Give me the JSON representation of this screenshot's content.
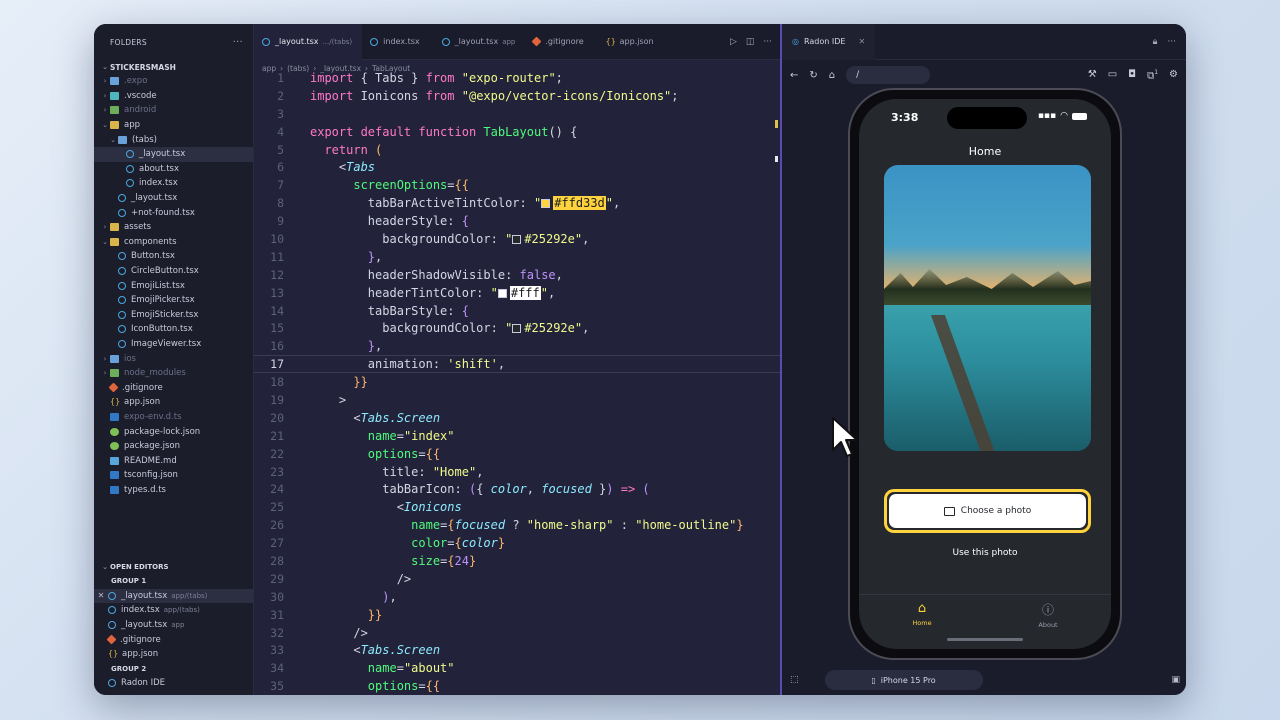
{
  "explorer": {
    "header": "FOLDERS",
    "more": "···",
    "project": "STICKERSMASH",
    "tree": [
      {
        "label": ".expo",
        "icon": "folder",
        "depth": 1,
        "chevron": "›",
        "dim": true
      },
      {
        "label": ".vscode",
        "icon": "folder-teal",
        "depth": 1,
        "chevron": "›"
      },
      {
        "label": "android",
        "icon": "folder-green",
        "depth": 1,
        "chevron": "›",
        "dim": true
      },
      {
        "label": "app",
        "icon": "folder-yellow",
        "depth": 1,
        "chevron": "⌄"
      },
      {
        "label": "(tabs)",
        "icon": "folder",
        "depth": 2,
        "chevron": "⌄"
      },
      {
        "label": "_layout.tsx",
        "icon": "tsx",
        "depth": 3,
        "active": true
      },
      {
        "label": "about.tsx",
        "icon": "tsx",
        "depth": 3
      },
      {
        "label": "index.tsx",
        "icon": "tsx",
        "depth": 3
      },
      {
        "label": "_layout.tsx",
        "icon": "tsx",
        "depth": 2
      },
      {
        "label": "+not-found.tsx",
        "icon": "tsx",
        "depth": 2
      },
      {
        "label": "assets",
        "icon": "folder-yellow",
        "depth": 1,
        "chevron": "›"
      },
      {
        "label": "components",
        "icon": "folder-yellow",
        "depth": 1,
        "chevron": "⌄"
      },
      {
        "label": "Button.tsx",
        "icon": "tsx",
        "depth": 2
      },
      {
        "label": "CircleButton.tsx",
        "icon": "tsx",
        "depth": 2
      },
      {
        "label": "EmojiList.tsx",
        "icon": "tsx",
        "depth": 2
      },
      {
        "label": "EmojiPicker.tsx",
        "icon": "tsx",
        "depth": 2
      },
      {
        "label": "EmojiSticker.tsx",
        "icon": "tsx",
        "depth": 2
      },
      {
        "label": "IconButton.tsx",
        "icon": "tsx",
        "depth": 2
      },
      {
        "label": "ImageViewer.tsx",
        "icon": "tsx",
        "depth": 2
      },
      {
        "label": "ios",
        "icon": "folder",
        "depth": 1,
        "chevron": "›",
        "dim": true
      },
      {
        "label": "node_modules",
        "icon": "folder-green",
        "depth": 1,
        "chevron": "›",
        "dim": true
      },
      {
        "label": ".gitignore",
        "icon": "git",
        "depth": 1
      },
      {
        "label": "app.json",
        "icon": "json",
        "depth": 1
      },
      {
        "label": "expo-env.d.ts",
        "icon": "ts",
        "depth": 1,
        "dim": true
      },
      {
        "label": "package-lock.json",
        "icon": "npm",
        "depth": 1
      },
      {
        "label": "package.json",
        "icon": "npm",
        "depth": 1
      },
      {
        "label": "README.md",
        "icon": "md",
        "depth": 1
      },
      {
        "label": "tsconfig.json",
        "icon": "ts",
        "depth": 1
      },
      {
        "label": "types.d.ts",
        "icon": "ts",
        "depth": 1
      }
    ],
    "open_editors_header": "OPEN EDITORS",
    "group1": "GROUP 1",
    "group2": "GROUP 2",
    "open_editors": [
      {
        "label": "_layout.tsx",
        "sub": "app/(tabs)",
        "icon": "tsx",
        "active": true,
        "close": "✕"
      },
      {
        "label": "index.tsx",
        "sub": "app/(tabs)",
        "icon": "tsx"
      },
      {
        "label": "_layout.tsx",
        "sub": "app",
        "icon": "tsx"
      },
      {
        "label": ".gitignore",
        "sub": "",
        "icon": "git"
      },
      {
        "label": "app.json",
        "sub": "",
        "icon": "json"
      }
    ],
    "group2_items": [
      {
        "label": "Radon IDE",
        "icon": "tsx"
      }
    ]
  },
  "editor": {
    "tabs": [
      {
        "label": "_layout.tsx",
        "sub": ".../(tabs)",
        "active": true
      },
      {
        "label": "index.tsx",
        "sub": ""
      },
      {
        "label": "_layout.tsx",
        "sub": "app"
      },
      {
        "label": ".gitignore",
        "sub": ""
      },
      {
        "label": "app.json",
        "sub": ""
      }
    ],
    "breadcrumbs": [
      "app",
      "(tabs)",
      "_layout.tsx",
      "TabLayout"
    ],
    "breadcrumb_sep": "›",
    "current_line": 17
  },
  "radon": {
    "tab_label": "Radon IDE",
    "url": "/",
    "device": "iPhone 15 Pro",
    "notification_count": "1"
  },
  "app": {
    "status_time": "3:38",
    "title": "Home",
    "choose_button": "Choose a photo",
    "use_photo": "Use this photo",
    "nav": [
      {
        "label": "Home",
        "active": true
      },
      {
        "label": "About",
        "active": false
      }
    ]
  },
  "colors": {
    "accent": "#ffd33d",
    "app_bg": "#25292e",
    "radon_border": "#5b4bb0"
  }
}
